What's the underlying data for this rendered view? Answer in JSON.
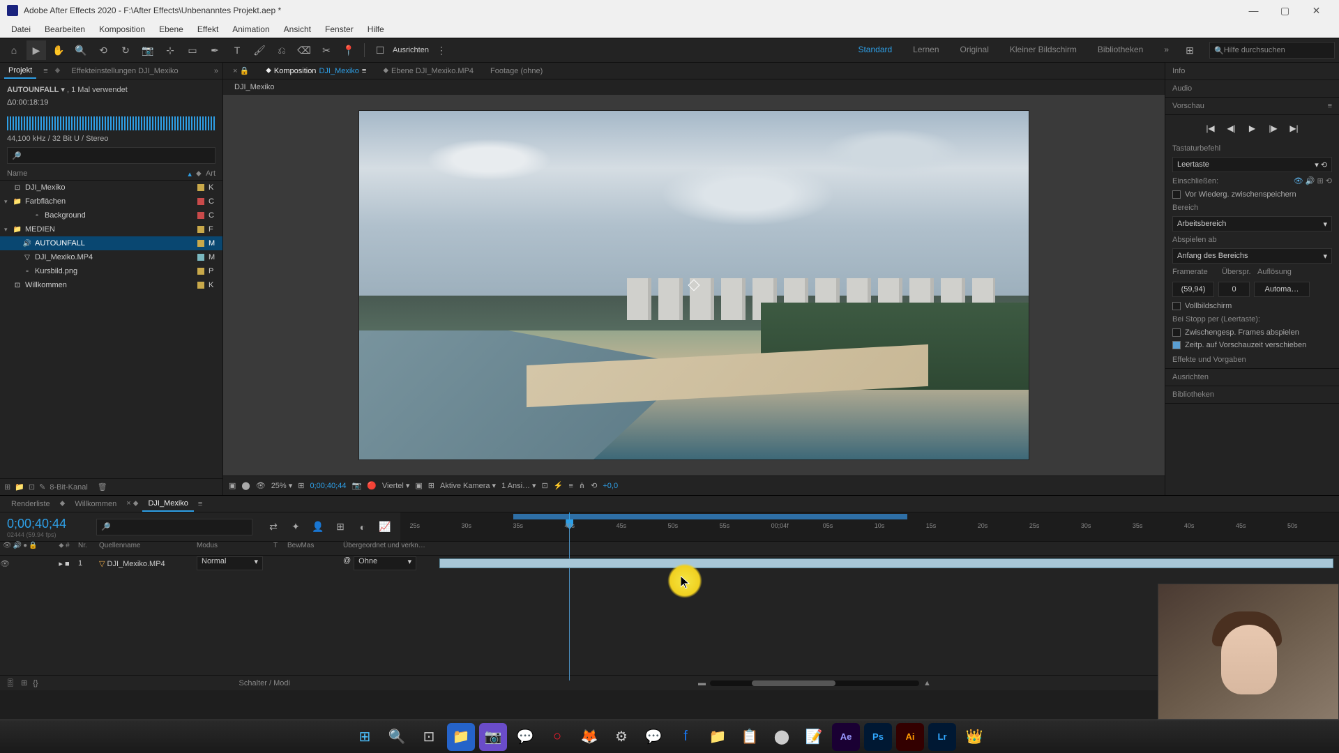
{
  "titlebar": {
    "app": "Adobe After Effects 2020",
    "path": "F:\\After Effects\\Unbenanntes Projekt.aep *"
  },
  "menu": [
    "Datei",
    "Bearbeiten",
    "Komposition",
    "Ebene",
    "Effekt",
    "Animation",
    "Ansicht",
    "Fenster",
    "Hilfe"
  ],
  "toolbar": {
    "snap": "Ausrichten"
  },
  "workspaces": [
    "Standard",
    "Lernen",
    "Original",
    "Kleiner Bildschirm",
    "Bibliotheken"
  ],
  "search_help": "Hilfe durchsuchen",
  "project": {
    "tab": "Projekt",
    "settings_tab": "Effekteinstellungen DJI_Mexiko",
    "sel_name": "AUTOUNFALL",
    "sel_info": ", 1 Mal verwendet",
    "sel_dur": "Δ0:00:18:19",
    "sel_audio": "44,100 kHz / 32 Bit U / Stereo",
    "cols": {
      "name": "Name",
      "type": "Art"
    },
    "items": [
      {
        "name": "DJI_Mexiko",
        "icon": "comp",
        "indent": 0,
        "twirl": "",
        "color": "#c9a94a",
        "t": "K"
      },
      {
        "name": "Farbflächen",
        "icon": "folder",
        "indent": 0,
        "twirl": "▾",
        "color": "#c94a4a",
        "t": "C"
      },
      {
        "name": "Background",
        "icon": "solid",
        "indent": 2,
        "twirl": "",
        "color": "#c94a4a",
        "t": "C"
      },
      {
        "name": "MEDIEN",
        "icon": "folder",
        "indent": 0,
        "twirl": "▾",
        "color": "#c9a94a",
        "t": "F"
      },
      {
        "name": "AUTOUNFALL",
        "icon": "audio",
        "indent": 1,
        "twirl": "",
        "color": "#c9a94a",
        "t": "M",
        "sel": true
      },
      {
        "name": "DJI_Mexiko.MP4",
        "icon": "video",
        "indent": 1,
        "twirl": "",
        "color": "#7ab8c0",
        "t": "M"
      },
      {
        "name": "Kursbild.png",
        "icon": "image",
        "indent": 1,
        "twirl": "",
        "color": "#c9a94a",
        "t": "P"
      },
      {
        "name": "Willkommen",
        "icon": "comp",
        "indent": 0,
        "twirl": "",
        "color": "#c9a94a",
        "t": "K"
      }
    ],
    "footer": "8-Bit-Kanal"
  },
  "comp": {
    "tabs": [
      {
        "label": "Komposition",
        "sub": "DJI_Mexiko",
        "active": true
      },
      {
        "label": "Ebene DJI_Mexiko.MP4"
      },
      {
        "label": "Footage (ohne)"
      }
    ],
    "breadcrumb": "DJI_Mexiko",
    "footer": {
      "zoom": "25%",
      "tc": "0;00;40;44",
      "res": "Viertel",
      "camera": "Aktive Kamera",
      "view": "1 Ansi…",
      "exp": "+0,0"
    }
  },
  "right": {
    "info": "Info",
    "audio": "Audio",
    "preview": "Vorschau",
    "shortcut_label": "Tastaturbefehl",
    "shortcut": "Leertaste",
    "include": "Einschließen:",
    "cache": "Vor Wiederg. zwischenspeichern",
    "range_label": "Bereich",
    "range": "Arbeitsbereich",
    "playfrom_label": "Abspielen ab",
    "playfrom": "Anfang des Bereichs",
    "fr_label": "Framerate",
    "skip_label": "Überspr.",
    "res_label": "Auflösung",
    "fr": "(59,94)",
    "skip": "0",
    "res": "Automa…",
    "fullscreen": "Vollbildschirm",
    "stop": "Bei Stopp per (Leertaste):",
    "stop1": "Zwischengesp. Frames abspielen",
    "stop2": "Zeitp. auf Vorschauzeit verschieben",
    "effects": "Effekte und Vorgaben",
    "align": "Ausrichten",
    "libs": "Bibliotheken"
  },
  "timeline": {
    "tabs": [
      "Renderliste",
      "Willkommen",
      "DJI_Mexiko"
    ],
    "timecode": "0;00;40;44",
    "sub": "02444 (59.94 fps)",
    "cols": {
      "nr": "Nr.",
      "src": "Quellenname",
      "mode": "Modus",
      "t": "T",
      "trk": "BewMas",
      "parent": "Übergeordnet und verkn…"
    },
    "ticks": [
      "25s",
      "30s",
      "35s",
      "40s",
      "45s",
      "50s",
      "55s",
      "00;04f",
      "05s",
      "10s",
      "15s",
      "20s",
      "25s",
      "30s",
      "35s",
      "40s",
      "45s",
      "50s"
    ],
    "layer": {
      "nr": "1",
      "name": "DJI_Mexiko.MP4",
      "mode": "Normal",
      "parent": "Ohne"
    },
    "footer": "Schalter / Modi"
  }
}
